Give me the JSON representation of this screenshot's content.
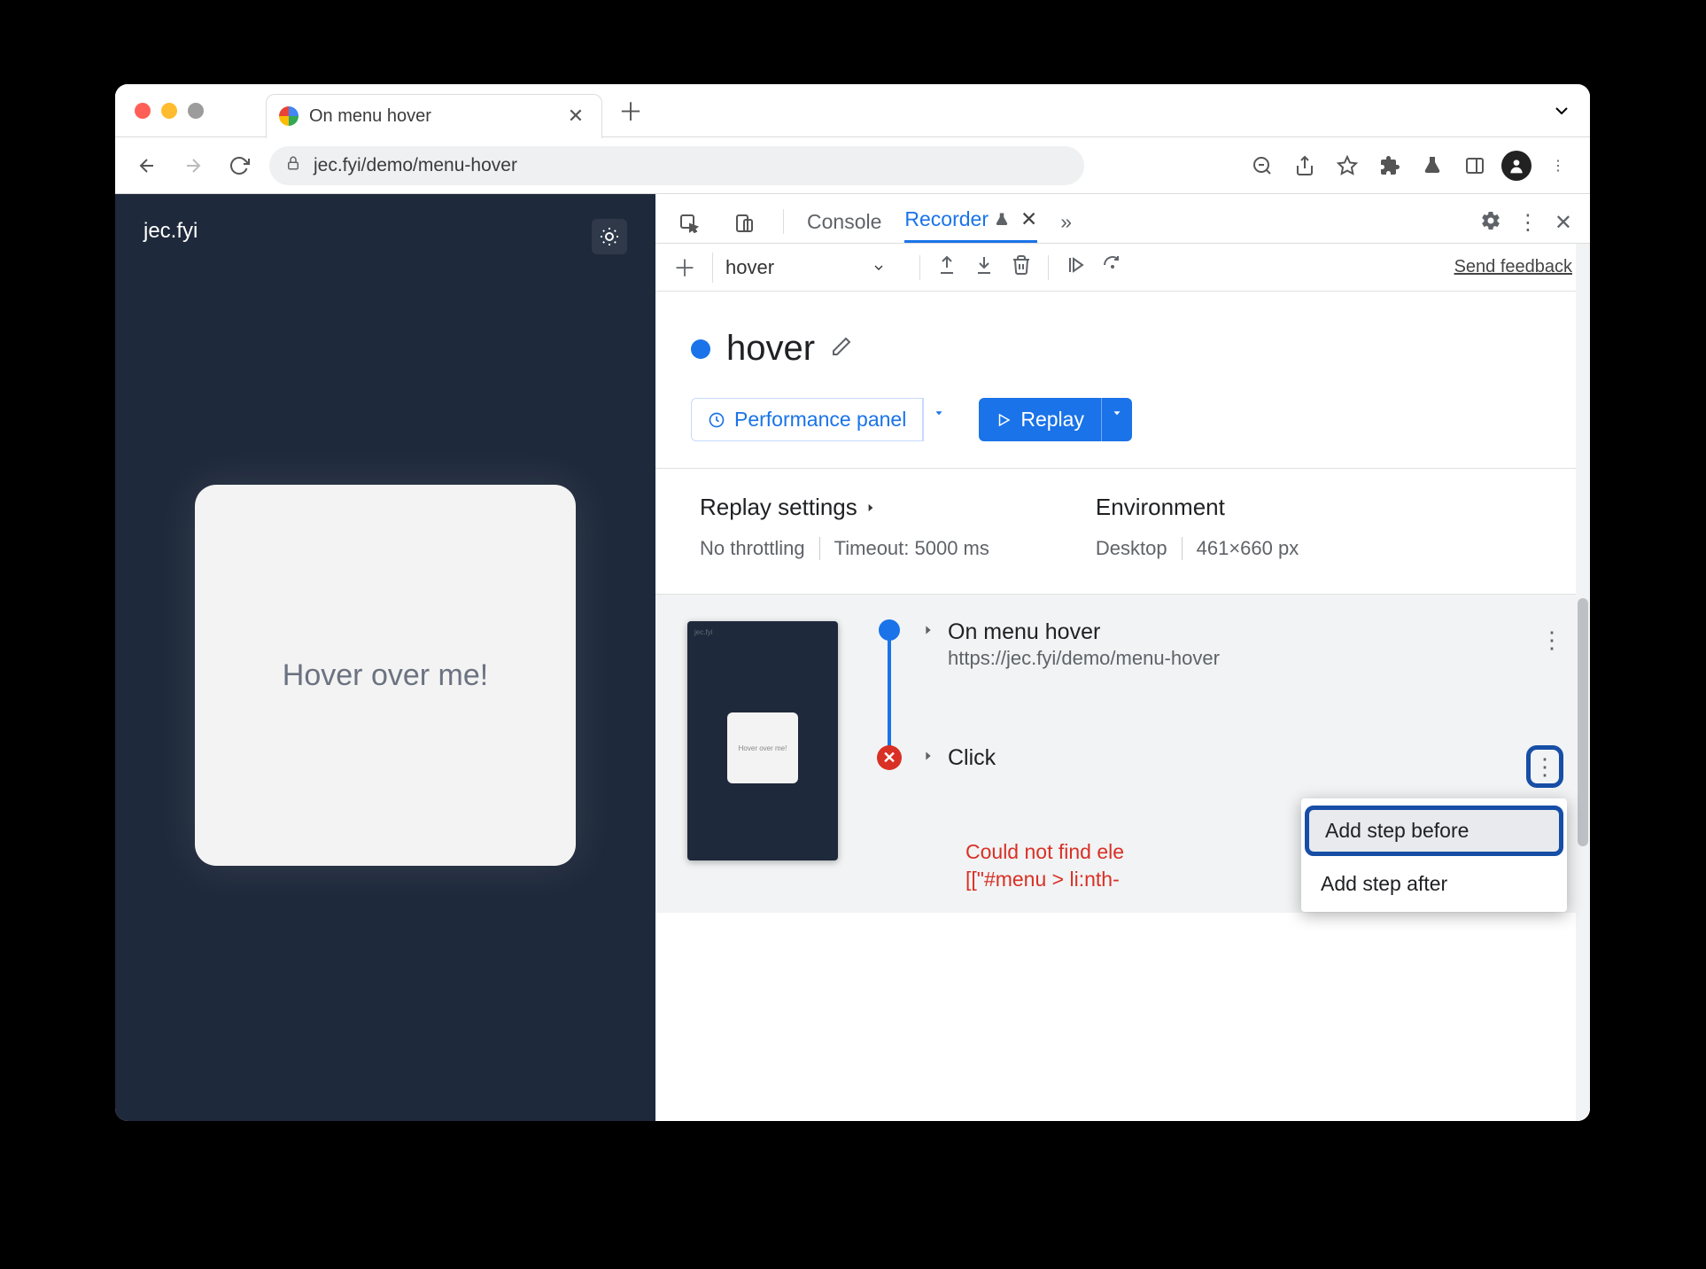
{
  "tab": {
    "title": "On menu hover"
  },
  "omnibox": {
    "url": "jec.fyi/demo/menu-hover"
  },
  "page": {
    "site_title": "jec.fyi",
    "card_text": "Hover over me!"
  },
  "devtools": {
    "tabs": {
      "console": "Console",
      "recorder": "Recorder"
    },
    "bar2": {
      "dropdown": "hover",
      "feedback": "Send feedback"
    },
    "recording": {
      "title": "hover"
    },
    "buttons": {
      "perf": "Performance panel",
      "replay": "Replay"
    },
    "settings": {
      "replay_hdr": "Replay settings",
      "throttle": "No throttling",
      "timeout": "Timeout: 5000 ms",
      "env_hdr": "Environment",
      "device": "Desktop",
      "viewport": "461×660 px"
    },
    "steps": {
      "s1_title": "On menu hover",
      "s1_url": "https://jec.fyi/demo/menu-hover",
      "s2_title": "Click",
      "error_l1": "Could not find ele",
      "error_l2": "[[\"#menu > li:nth-"
    },
    "menu": {
      "before": "Add step before",
      "after": "Add step after"
    },
    "thumb": {
      "mini": "Hover over me!"
    }
  }
}
